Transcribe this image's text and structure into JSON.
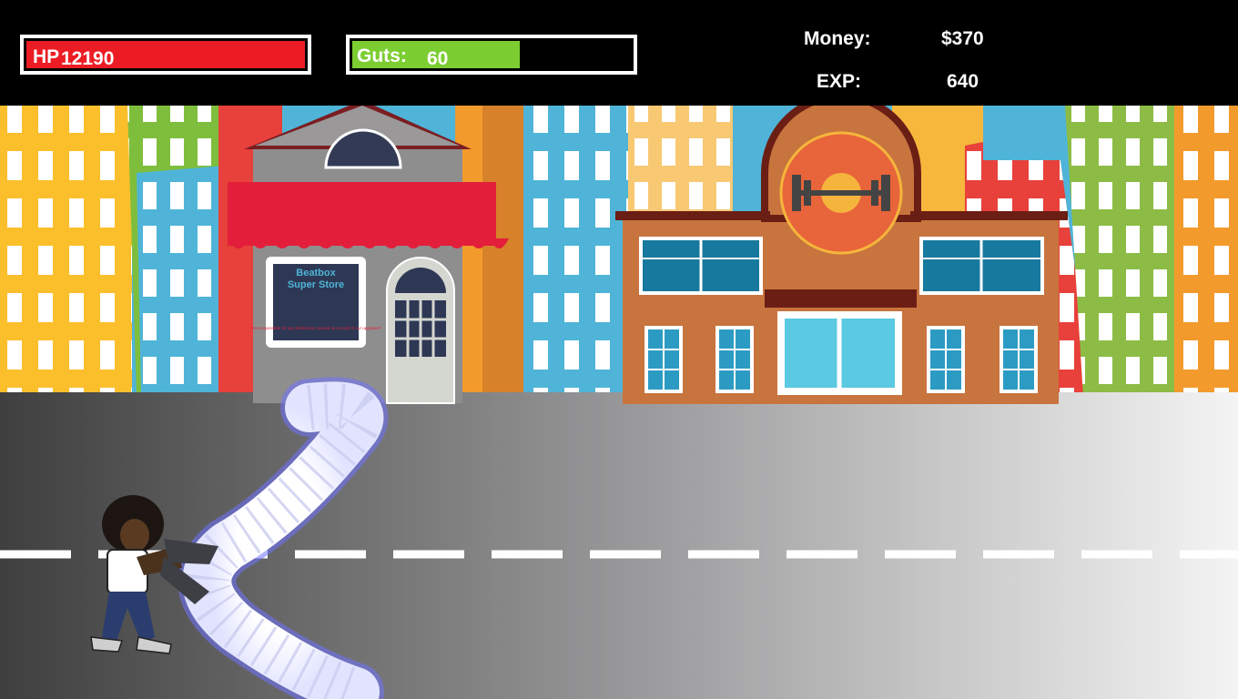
{
  "hud": {
    "hp": {
      "label": "HP",
      "value": "12190",
      "fill_fraction": 1.0,
      "color": "#ec1c24"
    },
    "guts": {
      "label": "Guts:",
      "value": "60",
      "fill_fraction": 0.6,
      "color": "#7ccd32"
    },
    "money": {
      "label": "Money:",
      "value": "$370"
    },
    "exp": {
      "label": "EXP:",
      "value": "640"
    }
  },
  "scene": {
    "store": {
      "sign_line1": "Beatbox",
      "sign_line2": "Super Store",
      "sign_note": "*Not responsible for any destruction caused as a result of our upgrades*",
      "awning_color": "#e31e3a"
    },
    "gym": {
      "logo_icon": "dumbbell-icon",
      "color": "#c8743e"
    }
  },
  "colors": {
    "road_dark": "#3f3f3f",
    "road_light": "#f4f4f4",
    "sky_buildings": [
      "#fbbf2c",
      "#7fbe3d",
      "#e8403a",
      "#4fb4d8",
      "#f39a2c"
    ]
  }
}
